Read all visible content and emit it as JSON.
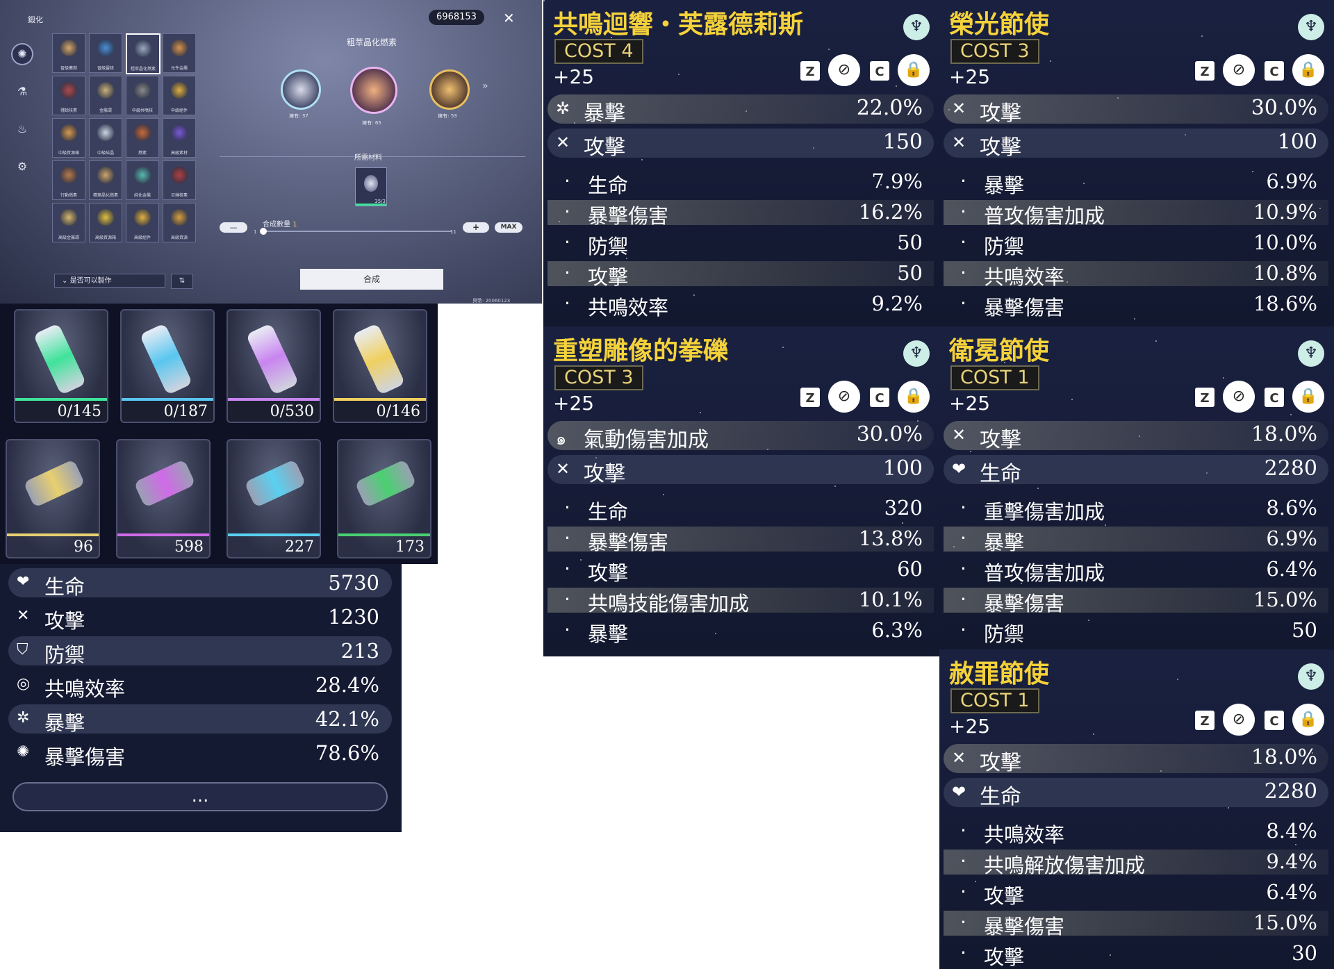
{
  "synthesis": {
    "title": "鍛化",
    "currency": "6968153",
    "selected_item": "粗萃晶化燃素",
    "grid_items": [
      {
        "label": "晉級藥劑",
        "color": "#d9a86a"
      },
      {
        "label": "晉級靈核",
        "color": "#4c8fd6"
      },
      {
        "label": "粗萃晶化燃素",
        "color": "#9aa8c4"
      },
      {
        "label": "元件金屬",
        "color": "#d6944c"
      },
      {
        "label": "殘餘核素",
        "color": "#b04a4a"
      },
      {
        "label": "金屬環",
        "color": "#c8b27a"
      },
      {
        "label": "中級共鳴核",
        "color": "#8a8a8a"
      },
      {
        "label": "中級組件",
        "color": "#e0b040"
      },
      {
        "label": "中級資源箱",
        "color": "#d69a4c"
      },
      {
        "label": "中級結晶",
        "color": "#c9d6e6"
      },
      {
        "label": "燃素",
        "color": "#c86a3a"
      },
      {
        "label": "高級素材",
        "color": "#7a5ad6"
      },
      {
        "label": "行動燃素",
        "color": "#b87a4a"
      },
      {
        "label": "精華晶化燃素",
        "color": "#caa46a"
      },
      {
        "label": "純化金屬",
        "color": "#5ab8b0"
      },
      {
        "label": "巨錘核素",
        "color": "#b04040"
      },
      {
        "label": "高級金屬環",
        "color": "#d6b86a"
      },
      {
        "label": "高級資源箱",
        "color": "#e0c040"
      },
      {
        "label": "高級組件",
        "color": "#e0b040"
      },
      {
        "label": "高級資源",
        "color": "#d6a040"
      }
    ],
    "chain": [
      {
        "label": "擁有: 37"
      },
      {
        "label": "擁有: 65"
      },
      {
        "label": "擁有: 53"
      }
    ],
    "required_title": "所需材料",
    "required_count": "35/3",
    "quantity_label": "合成數量",
    "quantity_value": "1",
    "quantity_min": "1",
    "quantity_max": "11",
    "max_label": "MAX",
    "filter_label": "是否可以製作",
    "sort_label": "⇅",
    "synth_button": "合成",
    "footnote": "貝幣: 20060123"
  },
  "tubes": [
    {
      "count": "0/145",
      "color": "#3fe39a"
    },
    {
      "count": "0/187",
      "color": "#59c6f0"
    },
    {
      "count": "0/530",
      "color": "#c884f0"
    },
    {
      "count": "0/146",
      "color": "#f0d060"
    }
  ],
  "cylinders": [
    {
      "count": "96",
      "color": "#e8d070"
    },
    {
      "count": "598",
      "color": "#d06ae8"
    },
    {
      "count": "227",
      "color": "#5ad0f0"
    },
    {
      "count": "173",
      "color": "#4ad070"
    }
  ],
  "stats": [
    {
      "icon": "❤",
      "label": "生命",
      "value": "5730"
    },
    {
      "icon": "✕",
      "label": "攻擊",
      "value": "1230"
    },
    {
      "icon": "⛉",
      "label": "防禦",
      "value": "213"
    },
    {
      "icon": "◎",
      "label": "共鳴效率",
      "value": "28.4%"
    },
    {
      "icon": "✲",
      "label": "暴擊",
      "value": "42.1%"
    },
    {
      "icon": "✺",
      "label": "暴擊傷害",
      "value": "78.6%"
    }
  ],
  "more_label": "...",
  "echoes": [
    {
      "title": "共鳴迴響・芙露德莉斯",
      "cost": "COST 4",
      "level": "+25",
      "main": [
        {
          "icon": "✲",
          "label": "暴擊",
          "value": "22.0%"
        },
        {
          "icon": "✕",
          "label": "攻擊",
          "value": "150"
        }
      ],
      "subs": [
        {
          "label": "生命",
          "value": "7.9%"
        },
        {
          "label": "暴擊傷害",
          "value": "16.2%"
        },
        {
          "label": "防禦",
          "value": "50"
        },
        {
          "label": "攻擊",
          "value": "50"
        },
        {
          "label": "共鳴效率",
          "value": "9.2%"
        }
      ]
    },
    {
      "title": "重塑雕像的拳礫",
      "cost": "COST 3",
      "level": "+25",
      "main": [
        {
          "icon": "๑",
          "label": "氣動傷害加成",
          "value": "30.0%"
        },
        {
          "icon": "✕",
          "label": "攻擊",
          "value": "100"
        }
      ],
      "subs": [
        {
          "label": "生命",
          "value": "320"
        },
        {
          "label": "暴擊傷害",
          "value": "13.8%"
        },
        {
          "label": "攻擊",
          "value": "60"
        },
        {
          "label": "共鳴技能傷害加成",
          "value": "10.1%"
        },
        {
          "label": "暴擊",
          "value": "6.3%"
        }
      ]
    },
    {
      "title": "榮光節使",
      "cost": "COST 3",
      "level": "+25",
      "main": [
        {
          "icon": "✕",
          "label": "攻擊",
          "value": "30.0%"
        },
        {
          "icon": "✕",
          "label": "攻擊",
          "value": "100"
        }
      ],
      "subs": [
        {
          "label": "暴擊",
          "value": "6.9%"
        },
        {
          "label": "普攻傷害加成",
          "value": "10.9%"
        },
        {
          "label": "防禦",
          "value": "10.0%"
        },
        {
          "label": "共鳴效率",
          "value": "10.8%"
        },
        {
          "label": "暴擊傷害",
          "value": "18.6%"
        }
      ]
    },
    {
      "title": "衛冕節使",
      "cost": "COST 1",
      "level": "+25",
      "main": [
        {
          "icon": "✕",
          "label": "攻擊",
          "value": "18.0%"
        },
        {
          "icon": "❤",
          "label": "生命",
          "value": "2280"
        }
      ],
      "subs": [
        {
          "label": "重擊傷害加成",
          "value": "8.6%"
        },
        {
          "label": "暴擊",
          "value": "6.9%"
        },
        {
          "label": "普攻傷害加成",
          "value": "6.4%"
        },
        {
          "label": "暴擊傷害",
          "value": "15.0%"
        },
        {
          "label": "防禦",
          "value": "50"
        }
      ]
    },
    {
      "title": "赦罪節使",
      "cost": "COST 1",
      "level": "+25",
      "main": [
        {
          "icon": "✕",
          "label": "攻擊",
          "value": "18.0%"
        },
        {
          "icon": "❤",
          "label": "生命",
          "value": "2280"
        }
      ],
      "subs": [
        {
          "label": "共鳴效率",
          "value": "8.4%"
        },
        {
          "label": "共鳴解放傷害加成",
          "value": "9.4%"
        },
        {
          "label": "攻擊",
          "value": "6.4%"
        },
        {
          "label": "暴擊傷害",
          "value": "15.0%"
        },
        {
          "label": "攻擊",
          "value": "30"
        }
      ]
    }
  ],
  "echo_controls": {
    "z": "Z",
    "c": "C",
    "discard": "⊘",
    "lock": "🔒",
    "badge": "♆"
  }
}
